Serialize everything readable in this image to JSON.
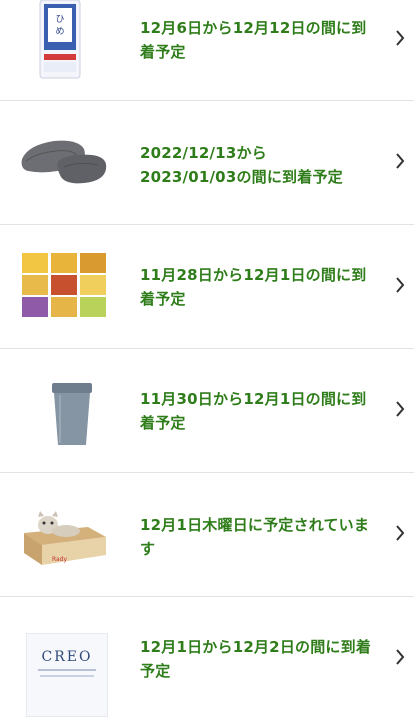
{
  "orders": [
    {
      "product_image": "rice-bag-image",
      "delivery_text": "12月6日から12月12日の間に到着予定"
    },
    {
      "product_image": "gray-slippers-image",
      "delivery_text": "2022/12/13から\n2023/01/03の間に到着予定"
    },
    {
      "product_image": "soup-box-assortment-image",
      "delivery_text": "11月28日から12月1日の間に到着予定"
    },
    {
      "product_image": "gray-trash-bin-image",
      "delivery_text": "11月30日から12月1日の間に到着予定"
    },
    {
      "product_image": "cat-scratcher-box-image",
      "delivery_text": "12月1日木曜日に予定されています"
    },
    {
      "product_image": "creo-product-box-image",
      "delivery_text": "12月1日から12月2日の間に到着予定"
    }
  ],
  "creo_box_label": "CREO",
  "colors": {
    "delivery_text": "#2f7d1a",
    "chevron": "#333333",
    "divider": "#e3e3e3"
  }
}
